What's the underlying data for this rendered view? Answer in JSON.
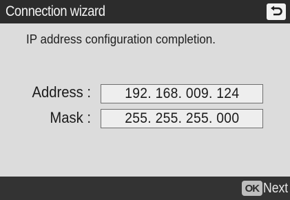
{
  "header": {
    "title": "Connection wizard",
    "back_icon": "return-arrow-icon"
  },
  "main": {
    "message": "IP address configuration completion.",
    "fields": [
      {
        "label": "Address :",
        "value": "192. 168. 009. 124"
      },
      {
        "label": "Mask :",
        "value": "255. 255. 255. 000"
      }
    ]
  },
  "footer": {
    "ok_label": "OK",
    "next_label": "Next"
  },
  "colors": {
    "title_bar": "#2c2c2c",
    "background": "#dcdcdc",
    "footer_bar": "#333333"
  }
}
